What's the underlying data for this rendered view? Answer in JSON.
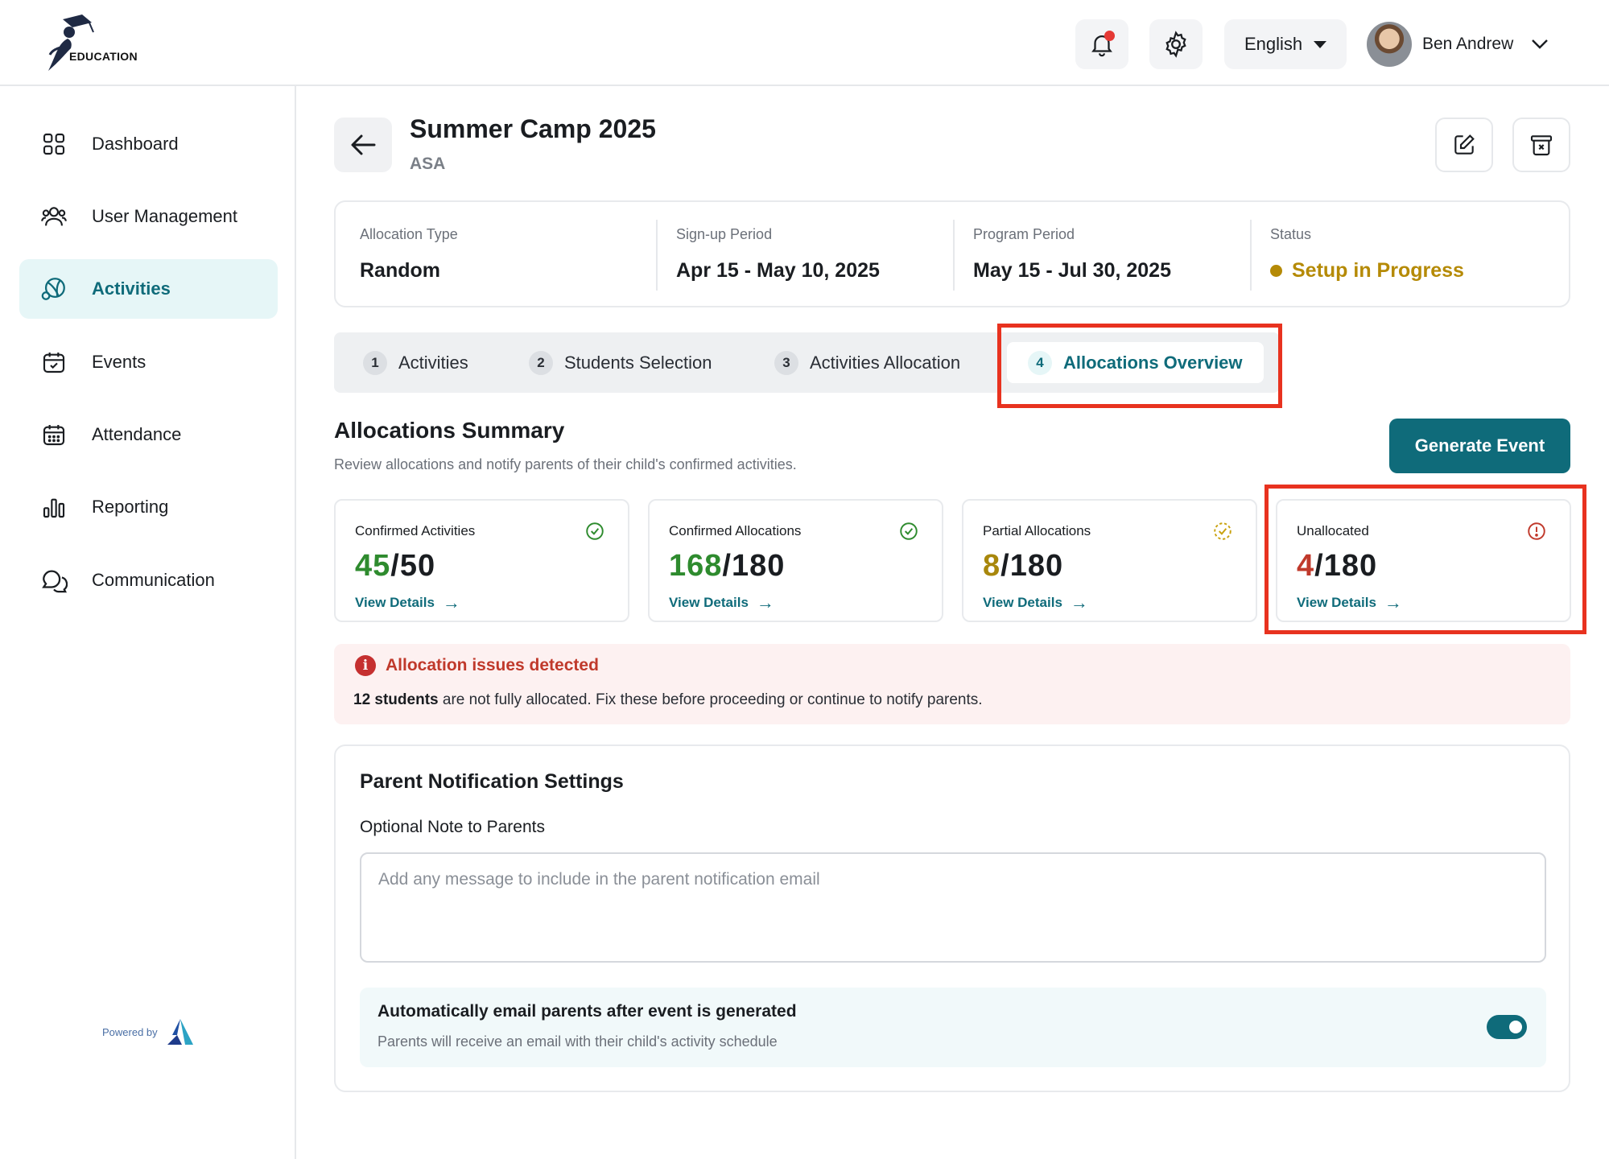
{
  "brand": {
    "logo_text": "EDUCATION",
    "powered_by": "Powered by"
  },
  "header": {
    "language": "English",
    "user_name": "Ben Andrew"
  },
  "sidebar": {
    "items": [
      {
        "label": "Dashboard",
        "icon": "dashboard-icon",
        "active": false
      },
      {
        "label": "User Management",
        "icon": "users-icon",
        "active": false
      },
      {
        "label": "Activities",
        "icon": "activities-icon",
        "active": true
      },
      {
        "label": "Events",
        "icon": "calendar-check-icon",
        "active": false
      },
      {
        "label": "Attendance",
        "icon": "calendar-grid-icon",
        "active": false
      },
      {
        "label": "Reporting",
        "icon": "bar-chart-icon",
        "active": false
      },
      {
        "label": "Communication",
        "icon": "chat-icon",
        "active": false
      }
    ]
  },
  "page": {
    "title": "Summer Camp 2025",
    "subtitle": "ASA"
  },
  "info": {
    "allocation_type": {
      "label": "Allocation Type",
      "value": "Random"
    },
    "signup_period": {
      "label": "Sign-up Period",
      "value": "Apr 15 - May 10, 2025"
    },
    "program_period": {
      "label": "Program Period",
      "value": "May 15 - Jul 30, 2025"
    },
    "status": {
      "label": "Status",
      "value": "Setup in Progress"
    }
  },
  "tabs": [
    {
      "num": "1",
      "label": "Activities"
    },
    {
      "num": "2",
      "label": "Students Selection"
    },
    {
      "num": "3",
      "label": "Activities Allocation"
    },
    {
      "num": "4",
      "label": "Allocations Overview"
    }
  ],
  "summary": {
    "title": "Allocations Summary",
    "subtitle": "Review allocations and notify parents of their child's confirmed activities.",
    "generate_button": "Generate Event"
  },
  "stats": [
    {
      "title": "Confirmed Activities",
      "value": "45",
      "total": "/50",
      "link": "View Details",
      "color": "#2e8b2e"
    },
    {
      "title": "Confirmed Allocations",
      "value": "168",
      "total": "/180",
      "link": "View Details",
      "color": "#2e8b2e"
    },
    {
      "title": "Partial Allocations",
      "value": "8",
      "total": "/180",
      "link": "View Details",
      "color": "#a8870c"
    },
    {
      "title": "Unallocated",
      "value": "4",
      "total": "/180",
      "link": "View Details",
      "color": "#c0392b"
    }
  ],
  "alert": {
    "title": "Allocation issues detected",
    "bold": "12 students",
    "body": " are not fully allocated. Fix these before proceeding or continue to notify parents."
  },
  "notification": {
    "title": "Parent Notification Settings",
    "note_label": "Optional Note to Parents",
    "note_placeholder": "Add any message to include in the parent notification email",
    "auto_title": "Automatically email parents after event is generated",
    "auto_sub": "Parents will receive an email with their child's activity schedule",
    "auto_enabled": true
  },
  "colors": {
    "accent": "#0f6b7a",
    "highlight": "#e8321f",
    "status": "#b58a06"
  }
}
